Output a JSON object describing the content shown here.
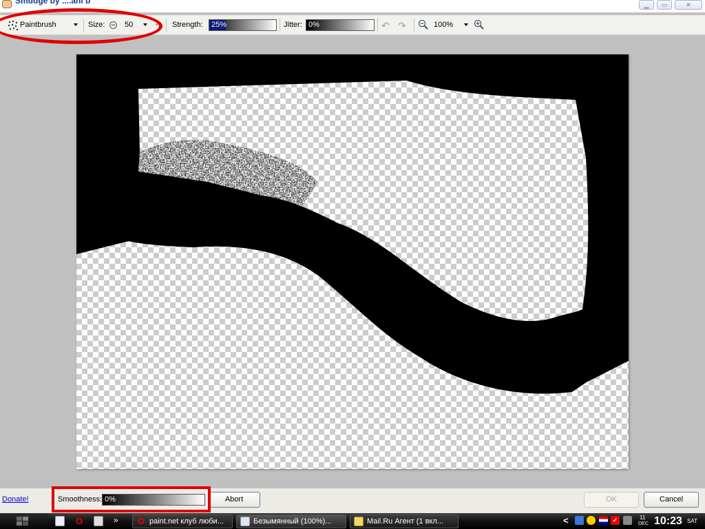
{
  "window": {
    "title": "Smudge by ....ahi b",
    "controls": [
      "minimize",
      "maximize",
      "close"
    ]
  },
  "toolbar": {
    "brush": {
      "value": "Paintbrush",
      "icon": "paintbrush-icon"
    },
    "size": {
      "label": "Size:",
      "value": "50"
    },
    "strength": {
      "label": "Strength:",
      "value": "25%",
      "fraction": 0.25
    },
    "jitter": {
      "label": "Jitter:",
      "value": "0%",
      "fraction": 0.0
    },
    "undo_icon": "undo-icon",
    "redo_icon": "redo-icon",
    "zoom": {
      "value": "100%",
      "zoom_out_icon": "zoom-out-icon",
      "zoom_in_icon": "zoom-in-icon"
    }
  },
  "bottom": {
    "donate": "Donate!",
    "smoothness": {
      "label": "Smoothness:",
      "value": "0%",
      "fraction": 0.0
    },
    "abort": "Abort",
    "ok": "OK",
    "cancel": "Cancel"
  },
  "taskbar": {
    "more": "»",
    "tasks": [
      {
        "label": "paint.net клуб люби...",
        "icon": "opera-icon"
      },
      {
        "label": "Безымянный (100%)...",
        "icon": "paintnet-icon"
      },
      {
        "label": "Mail.Ru Агент (1 вкл...",
        "icon": "mail-agent-icon"
      }
    ],
    "tray_arrow": "<",
    "clock": {
      "day": "11",
      "month": "DEC",
      "time": "10:23",
      "weekday": "SAT"
    }
  },
  "colors": {
    "annotation": "#e00000",
    "strength_fill": "#0a1a7a",
    "toolbar_bg": "#f1f1ed",
    "workspace_bg": "#c0c0c0"
  }
}
